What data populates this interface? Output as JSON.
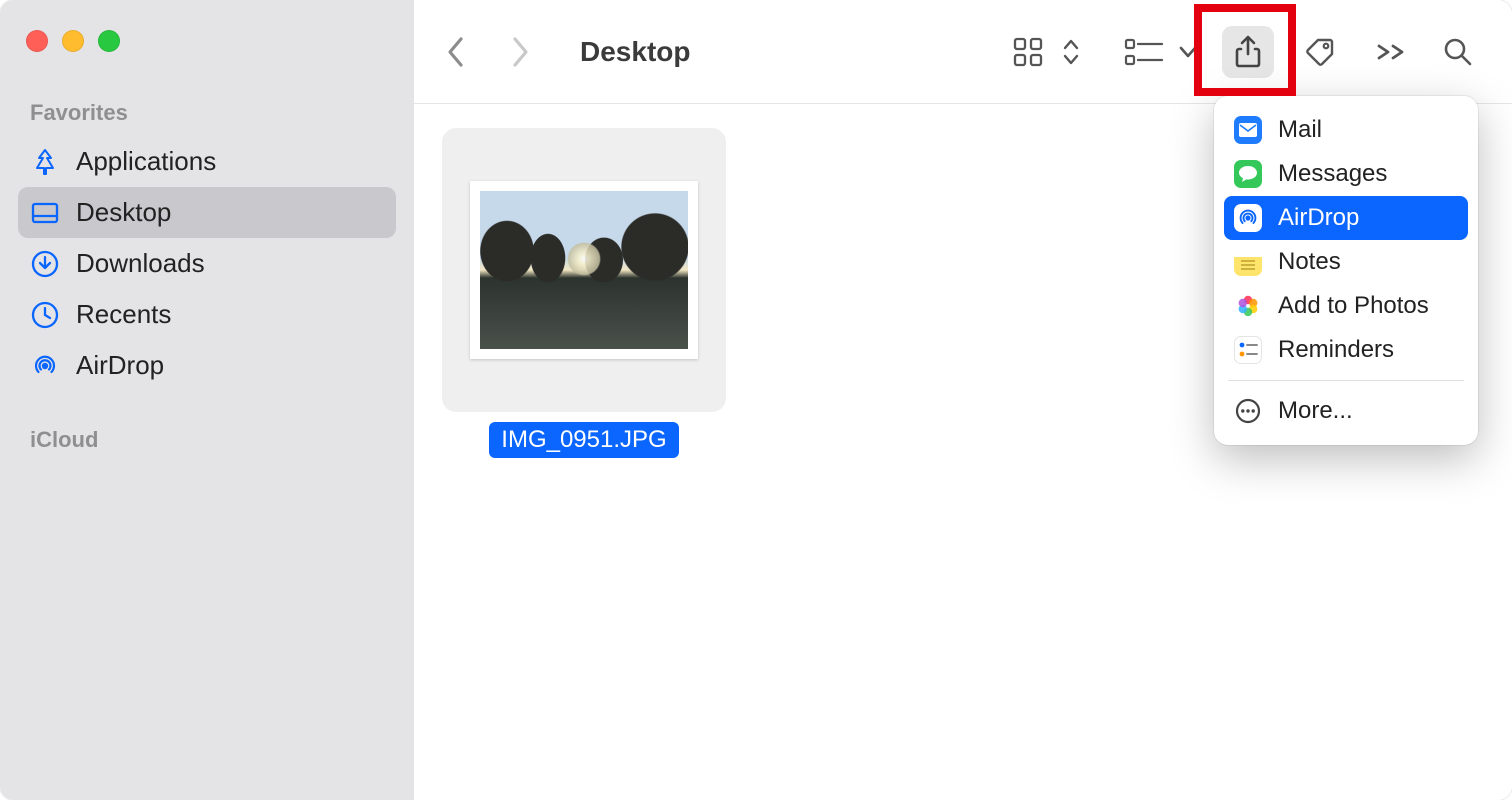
{
  "window_title": "Desktop",
  "sidebar": {
    "sections": [
      {
        "title": "Favorites",
        "items": [
          {
            "label": "Applications",
            "icon": "applications",
            "selected": false
          },
          {
            "label": "Desktop",
            "icon": "desktop",
            "selected": true
          },
          {
            "label": "Downloads",
            "icon": "downloads",
            "selected": false
          },
          {
            "label": "Recents",
            "icon": "recents",
            "selected": false
          },
          {
            "label": "AirDrop",
            "icon": "airdrop",
            "selected": false
          }
        ]
      },
      {
        "title": "iCloud",
        "items": []
      }
    ]
  },
  "toolbar": {
    "share_highlighted": true
  },
  "files": [
    {
      "name": "IMG_0951.JPG",
      "selected": true
    }
  ],
  "share_menu": {
    "open": true,
    "items": [
      {
        "label": "Mail",
        "icon": "mail",
        "selected": false
      },
      {
        "label": "Messages",
        "icon": "messages",
        "selected": false
      },
      {
        "label": "AirDrop",
        "icon": "airdrop-m",
        "selected": true
      },
      {
        "label": "Notes",
        "icon": "notes",
        "selected": false
      },
      {
        "label": "Add to Photos",
        "icon": "photos",
        "selected": false
      },
      {
        "label": "Reminders",
        "icon": "reminders",
        "selected": false
      }
    ],
    "more_label": "More..."
  }
}
